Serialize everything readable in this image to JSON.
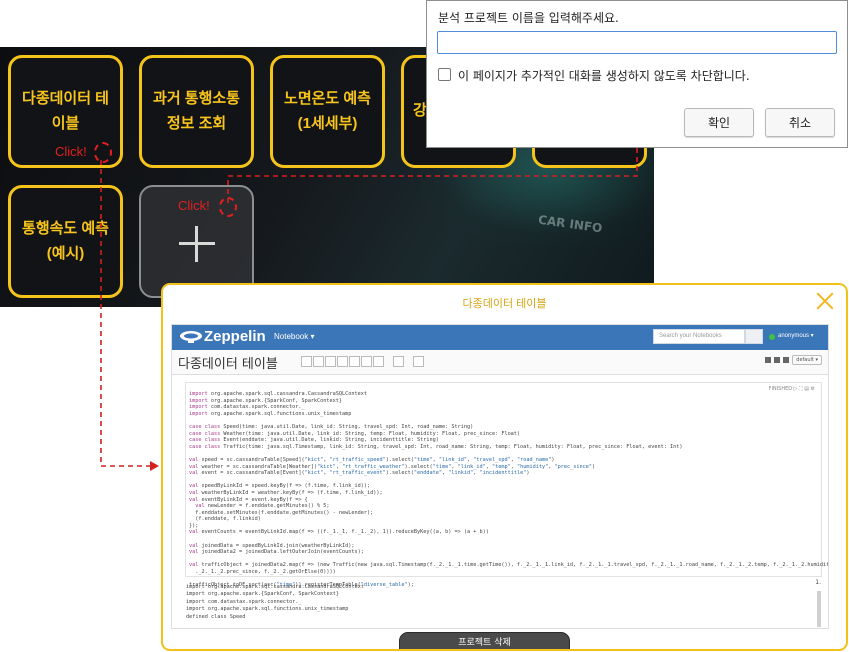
{
  "dashboard": {
    "tiles": [
      {
        "label": "다종데이터 테\n이블"
      },
      {
        "label": "과거 통행소통\n정보 조회"
      },
      {
        "label": "노면온도 예측\n(1세세부)"
      },
      {
        "label": "강"
      },
      {
        "label": ""
      },
      {
        "label": "통행속도 예측\n(예시)"
      }
    ],
    "add_tile_icon": "plus-icon",
    "click_labels": [
      "Click!",
      "Click!"
    ],
    "background_text": "CAR INFO"
  },
  "prompt": {
    "message": "분석 프로젝트 이름을 입력해주세요.",
    "input_value": "",
    "checkbox_label": "이 페이지가 추가적인 대화를 생성하지 않도록 차단합니다.",
    "confirm_label": "확인",
    "cancel_label": "취소"
  },
  "modal": {
    "title": "다종데이터 테이블",
    "close_icon": "close-icon",
    "delete_button": "프로젝트 삭제",
    "zeppelin": {
      "brand": "Zeppelin",
      "notebook_menu": "Notebook ▾",
      "search_placeholder": "Search your Notebooks",
      "user": "anonymous ▾",
      "note_title": "다종데이터 테이블",
      "interpreter": "default ▾",
      "paragraph_status": "FINISHED ▷ ⛶ ▤ ⚙",
      "code_lines": [
        "import org.apache.spark.sql.cassandra.CassandraSQLContext",
        "import org.apache.spark.{SparkConf, SparkContext}",
        "import com.datastax.spark.connector._",
        "import org.apache.spark.sql.functions.unix_timestamp",
        "",
        "case class Speed(time: java.util.Date, link_id: String, travel_spd: Int, road_name: String)",
        "case class Weather(time: java.util.Date, link_id: String, temp: Float, humidity: Float, prec_since: Float)",
        "case class Event(enddate: java.util.Date, linkid: String, incidenttitle: String)",
        "case class Traffic(time: java.sql.Timestamp, link_id: String, travel_spd: Int, road_name: String, temp: Float, humidity: Float, prec_since: Float, event: Int)",
        "",
        "val speed = sc.cassandraTable[Speed](\"kict\", \"rt_traffic_speed\").select(\"time\", \"link_id\", \"travel_spd\", \"road_name\")",
        "val weather = sc.cassandraTable[Weather](\"kict\", \"rt_traffic_weather\").select(\"time\", \"link_id\", \"temp\", \"humidity\", \"prec_since\")",
        "val event = sc.cassandraTable[Event](\"kict\", \"rt_traffic_event\").select(\"enddate\", \"linkid\", \"incidenttitle\")",
        "",
        "val speedByLinkId = speed.keyBy(f => (f.time, f.link_id));",
        "val weatherByLinkId = weather.keyBy(f => (f.time, f.link_id));",
        "val eventByLinkId = event.keyBy(f => {",
        "  val newLender = f.enddate.getMinutes() % 5;",
        "  f.enddate.setMinutes(f.enddate.getMinutes() - newLender);",
        "  (f.enddate, f.linkid)",
        "});",
        "val eventCounts = eventByLinkId.map(f => ((f._1._1, f._1._2), 1)).reduceByKey((a, b) => (a + b))",
        "",
        "val joinedData = speedByLinkId.join(weatherByLinkId);",
        "val joinedData2 = joinedData.leftOuterJoin(eventCounts);",
        "",
        "val trafficObject = joinedData2.map(f => (new Traffic(new java.sql.Timestamp(f._2._1._1.time.getTime()), f._2._1._1.link_id, f._2._1._1.travel_spd, f._2._1._1.road_name, f._2._1._2.temp, f._2._1._2.humidity, f",
        "  ._2._1._2.prec_since, f._2._2.getOrElse(0))))",
        "",
        "trafficObject.toDF.sort(asc(\"time\")).registerTempTable(\"diverse_table\");"
      ],
      "output_lines": [
        "import org.apache.spark.sql.cassandra.CassandraSQLContext",
        "import org.apache.spark.{SparkConf, SparkContext}",
        "import com.datastax.spark.connector._",
        "import org.apache.spark.sql.functions.unix_timestamp",
        "defined class Speed"
      ],
      "output_page": "1."
    }
  },
  "colors": {
    "tile_border": "#f5c41a",
    "tile_text": "#f7c51c",
    "click_red": "#e32020",
    "zeppelin_nav": "#3b76b8",
    "modal_border": "#f3c21a"
  }
}
